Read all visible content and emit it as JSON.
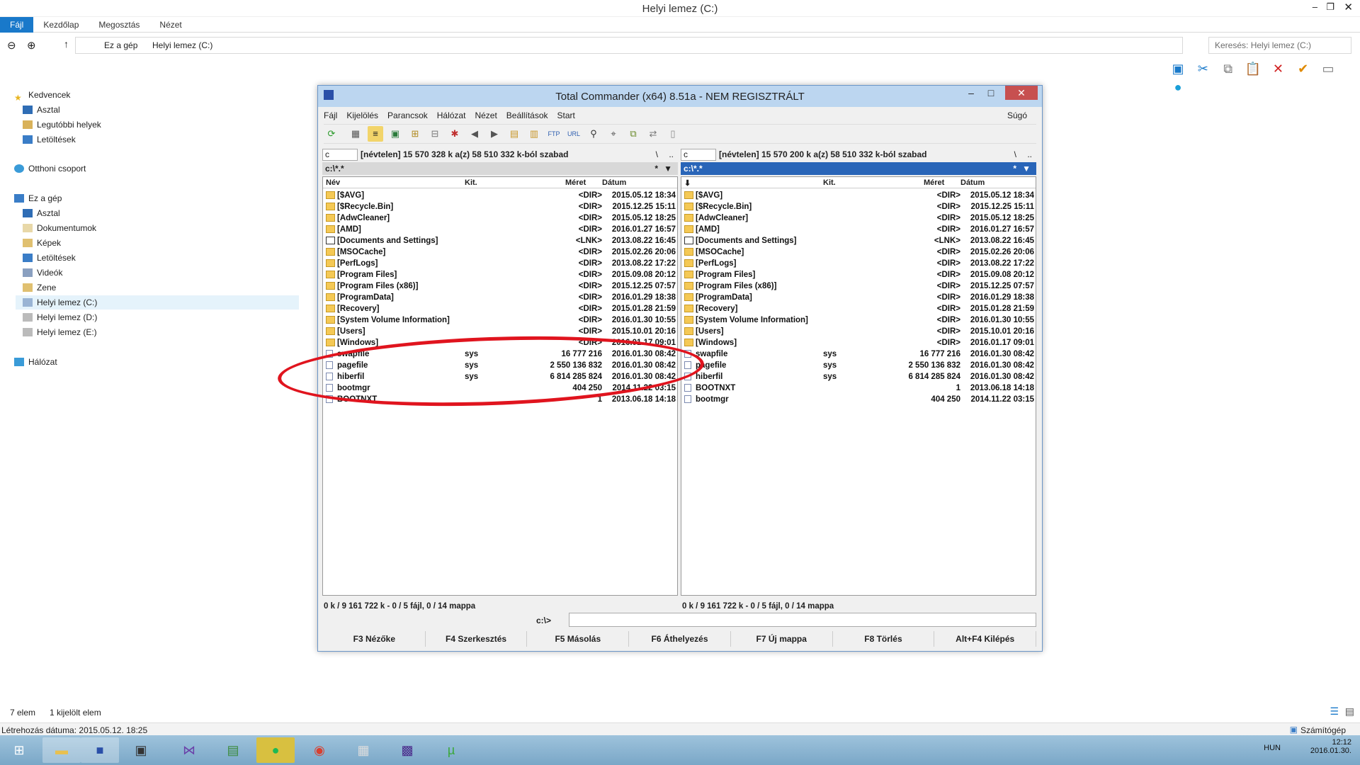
{
  "explorer": {
    "title": "Helyi lemez (C:)",
    "ribbon_tabs": [
      "Fájl",
      "Kezdőlap",
      "Megosztás",
      "Nézet"
    ],
    "breadcrumb": [
      "Ez a gép",
      "Helyi lemez (C:)"
    ],
    "search_placeholder": "Keresés: Helyi lemez (C:)",
    "nav": {
      "favorites": "Kedvencek",
      "fav_items": [
        "Asztal",
        "Legutóbbi helyek",
        "Letöltések"
      ],
      "homegroup": "Otthoni csoport",
      "this_pc": "Ez a gép",
      "pc_items": [
        "Asztal",
        "Dokumentumok",
        "Képek",
        "Letöltések",
        "Videók",
        "Zene",
        "Helyi lemez (C:)",
        "Helyi lemez (D:)",
        "Helyi lemez (E:)"
      ],
      "network": "Hálózat"
    },
    "status_count": "7 elem",
    "status_selected": "1 kijelölt elem",
    "created_label": "Létrehozás dátuma: 2015.05.12. 18:25",
    "computer_label": "Számítógép"
  },
  "tc": {
    "title": "Total Commander (x64) 8.51a - NEM REGISZTRÁLT",
    "menu": [
      "Fájl",
      "Kijelölés",
      "Parancsok",
      "Hálózat",
      "Nézet",
      "Beállítások",
      "Start"
    ],
    "help": "Súgó",
    "left": {
      "drive": "c",
      "info": "[névtelen]  15 570 328 k a(z) 58 510 332 k-ból szabad",
      "path": "c:\\*.*",
      "status": "0 k / 9 161 722 k - 0 / 5 fájl, 0 / 14 mappa"
    },
    "right": {
      "drive": "c",
      "info": "[névtelen]  15 570 200 k a(z) 58 510 332 k-ból szabad",
      "path": "c:\\*.*",
      "status": "0 k / 9 161 722 k - 0 / 5 fájl, 0 / 14 mappa"
    },
    "headers": {
      "name": "Név",
      "ext": "Kit.",
      "size": "Méret",
      "date": "Dátum"
    },
    "left_files": [
      {
        "n": "[$AVG]",
        "e": "",
        "s": "<DIR>",
        "d": "2015.05.12 18:34",
        "t": "dir"
      },
      {
        "n": "[$Recycle.Bin]",
        "e": "",
        "s": "<DIR>",
        "d": "2015.12.25 15:11",
        "t": "dir"
      },
      {
        "n": "[AdwCleaner]",
        "e": "",
        "s": "<DIR>",
        "d": "2015.05.12 18:25",
        "t": "dir"
      },
      {
        "n": "[AMD]",
        "e": "",
        "s": "<DIR>",
        "d": "2016.01.27 16:57",
        "t": "dir"
      },
      {
        "n": "[Documents and Settings]",
        "e": "",
        "s": "<LNK>",
        "d": "2013.08.22 16:45",
        "t": "lnk"
      },
      {
        "n": "[MSOCache]",
        "e": "",
        "s": "<DIR>",
        "d": "2015.02.26 20:06",
        "t": "dir"
      },
      {
        "n": "[PerfLogs]",
        "e": "",
        "s": "<DIR>",
        "d": "2013.08.22 17:22",
        "t": "dir"
      },
      {
        "n": "[Program Files]",
        "e": "",
        "s": "<DIR>",
        "d": "2015.09.08 20:12",
        "t": "dir"
      },
      {
        "n": "[Program Files (x86)]",
        "e": "",
        "s": "<DIR>",
        "d": "2015.12.25 07:57",
        "t": "dir"
      },
      {
        "n": "[ProgramData]",
        "e": "",
        "s": "<DIR>",
        "d": "2016.01.29 18:38",
        "t": "dir"
      },
      {
        "n": "[Recovery]",
        "e": "",
        "s": "<DIR>",
        "d": "2015.01.28 21:59",
        "t": "dir"
      },
      {
        "n": "[System Volume Information]",
        "e": "",
        "s": "<DIR>",
        "d": "2016.01.30 10:55",
        "t": "dir"
      },
      {
        "n": "[Users]",
        "e": "",
        "s": "<DIR>",
        "d": "2015.10.01 20:16",
        "t": "dir"
      },
      {
        "n": "[Windows]",
        "e": "",
        "s": "<DIR>",
        "d": "2016.01.17 09:01",
        "t": "dir"
      },
      {
        "n": "swapfile",
        "e": "sys",
        "s": "16 777 216",
        "d": "2016.01.30 08:42",
        "t": "file"
      },
      {
        "n": "pagefile",
        "e": "sys",
        "s": "2 550 136 832",
        "d": "2016.01.30 08:42",
        "t": "file"
      },
      {
        "n": "hiberfil",
        "e": "sys",
        "s": "6 814 285 824",
        "d": "2016.01.30 08:42",
        "t": "file"
      },
      {
        "n": "bootmgr",
        "e": "",
        "s": "404 250",
        "d": "2014.11.22 03:15",
        "t": "file"
      },
      {
        "n": "BOOTNXT",
        "e": "",
        "s": "1",
        "d": "2013.06.18 14:18",
        "t": "file"
      }
    ],
    "right_files": [
      {
        "n": "[$AVG]",
        "e": "",
        "s": "<DIR>",
        "d": "2015.05.12 18:34",
        "t": "dir"
      },
      {
        "n": "[$Recycle.Bin]",
        "e": "",
        "s": "<DIR>",
        "d": "2015.12.25 15:11",
        "t": "dir"
      },
      {
        "n": "[AdwCleaner]",
        "e": "",
        "s": "<DIR>",
        "d": "2015.05.12 18:25",
        "t": "dir"
      },
      {
        "n": "[AMD]",
        "e": "",
        "s": "<DIR>",
        "d": "2016.01.27 16:57",
        "t": "dir"
      },
      {
        "n": "[Documents and Settings]",
        "e": "",
        "s": "<LNK>",
        "d": "2013.08.22 16:45",
        "t": "lnk"
      },
      {
        "n": "[MSOCache]",
        "e": "",
        "s": "<DIR>",
        "d": "2015.02.26 20:06",
        "t": "dir"
      },
      {
        "n": "[PerfLogs]",
        "e": "",
        "s": "<DIR>",
        "d": "2013.08.22 17:22",
        "t": "dir"
      },
      {
        "n": "[Program Files]",
        "e": "",
        "s": "<DIR>",
        "d": "2015.09.08 20:12",
        "t": "dir"
      },
      {
        "n": "[Program Files (x86)]",
        "e": "",
        "s": "<DIR>",
        "d": "2015.12.25 07:57",
        "t": "dir"
      },
      {
        "n": "[ProgramData]",
        "e": "",
        "s": "<DIR>",
        "d": "2016.01.29 18:38",
        "t": "dir"
      },
      {
        "n": "[Recovery]",
        "e": "",
        "s": "<DIR>",
        "d": "2015.01.28 21:59",
        "t": "dir"
      },
      {
        "n": "[System Volume Information]",
        "e": "",
        "s": "<DIR>",
        "d": "2016.01.30 10:55",
        "t": "dir"
      },
      {
        "n": "[Users]",
        "e": "",
        "s": "<DIR>",
        "d": "2015.10.01 20:16",
        "t": "dir"
      },
      {
        "n": "[Windows]",
        "e": "",
        "s": "<DIR>",
        "d": "2016.01.17 09:01",
        "t": "dir"
      },
      {
        "n": "swapfile",
        "e": "sys",
        "s": "16 777 216",
        "d": "2016.01.30 08:42",
        "t": "file"
      },
      {
        "n": "pagefile",
        "e": "sys",
        "s": "2 550 136 832",
        "d": "2016.01.30 08:42",
        "t": "file"
      },
      {
        "n": "hiberfil",
        "e": "sys",
        "s": "6 814 285 824",
        "d": "2016.01.30 08:42",
        "t": "file"
      },
      {
        "n": "BOOTNXT",
        "e": "",
        "s": "1",
        "d": "2013.06.18 14:18",
        "t": "file"
      },
      {
        "n": "bootmgr",
        "e": "",
        "s": "404 250",
        "d": "2014.11.22 03:15",
        "t": "file"
      }
    ],
    "cmd_label": "c:\\>",
    "fkeys": [
      "F3 Nézőke",
      "F4 Szerkesztés",
      "F5 Másolás",
      "F6 Áthelyezés",
      "F7 Új mappa",
      "F8 Törlés",
      "Alt+F4 Kilépés"
    ]
  },
  "tray": {
    "lang": "HUN",
    "time": "12:12",
    "date": "2016.01.30."
  },
  "colors": {
    "annotation": "#e0141e",
    "accent": "#1979ca",
    "active_path": "#2965b8"
  }
}
